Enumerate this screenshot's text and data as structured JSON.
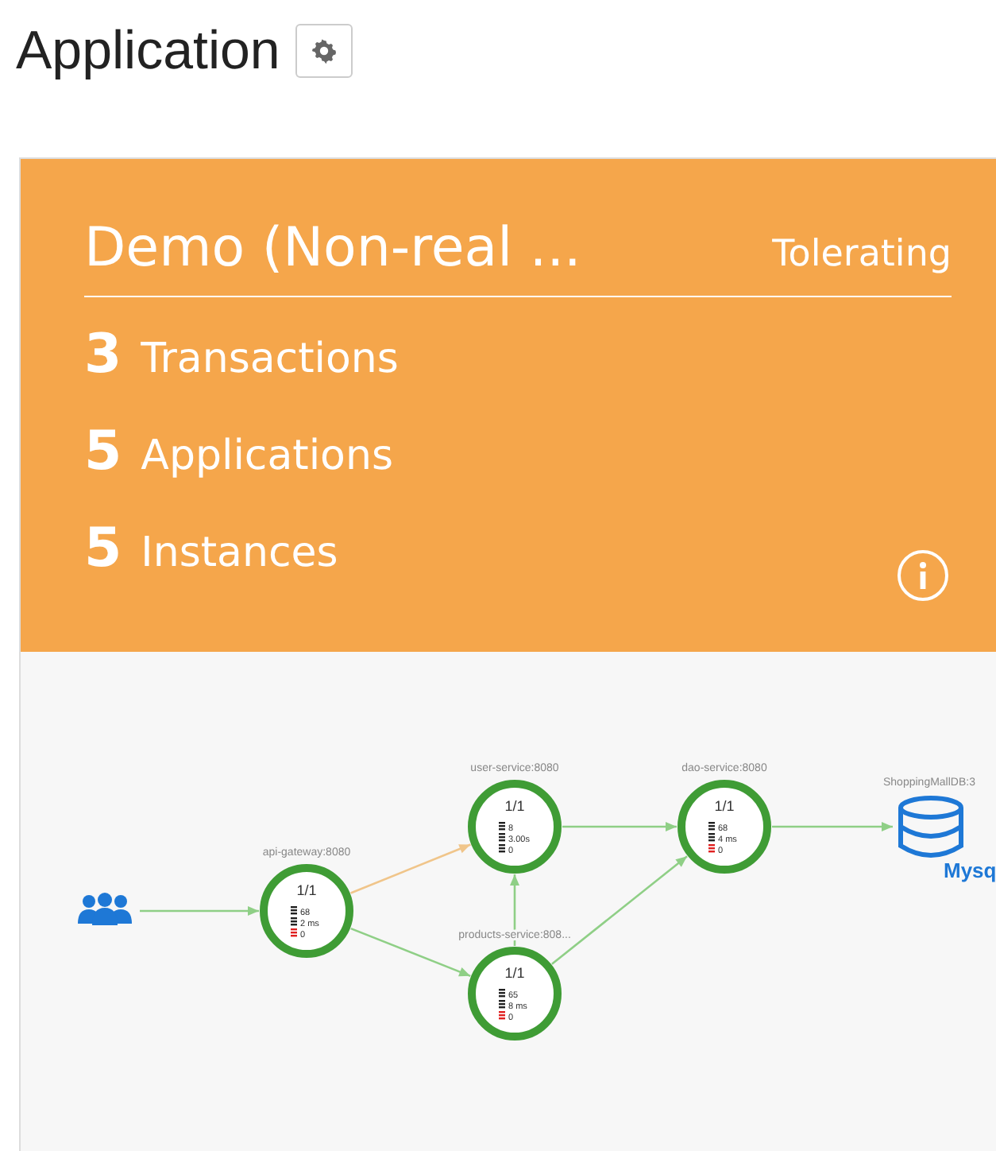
{
  "page": {
    "title": "Application"
  },
  "card": {
    "name": "Demo (Non-real ...",
    "status": "Tolerating",
    "stats": [
      {
        "count": "3",
        "label": "Transactions"
      },
      {
        "count": "5",
        "label": "Applications"
      },
      {
        "count": "5",
        "label": "Instances"
      }
    ]
  },
  "diagram": {
    "nodes": [
      {
        "kind": "users"
      },
      {
        "kind": "service",
        "label": "api-gateway:8080",
        "ratio": "1/1",
        "metrics": [
          {
            "text": "68",
            "error": false
          },
          {
            "text": "2 ms",
            "error": false
          },
          {
            "text": "0",
            "error": true
          }
        ]
      },
      {
        "kind": "service",
        "label": "user-service:8080",
        "ratio": "1/1",
        "metrics": [
          {
            "text": "8",
            "error": false
          },
          {
            "text": "3.00s",
            "error": false
          },
          {
            "text": "0",
            "error": false
          }
        ]
      },
      {
        "kind": "service",
        "label": "products-service:808...",
        "ratio": "1/1",
        "metrics": [
          {
            "text": "65",
            "error": false
          },
          {
            "text": "8 ms",
            "error": false
          },
          {
            "text": "0",
            "error": true
          }
        ]
      },
      {
        "kind": "service",
        "label": "dao-service:8080",
        "ratio": "1/1",
        "metrics": [
          {
            "text": "68",
            "error": false
          },
          {
            "text": "4 ms",
            "error": false
          },
          {
            "text": "0",
            "error": true
          }
        ]
      },
      {
        "kind": "database",
        "label": "ShoppingMallDB:3",
        "caption": "Mysq"
      }
    ],
    "edges": [
      {
        "color": "#8fcf86"
      },
      {
        "color": "#f0c58a"
      },
      {
        "color": "#8fcf86"
      },
      {
        "color": "#8fcf86"
      },
      {
        "color": "#8fcf86"
      },
      {
        "color": "#8fcf86"
      },
      {
        "color": "#8fcf86"
      }
    ]
  }
}
